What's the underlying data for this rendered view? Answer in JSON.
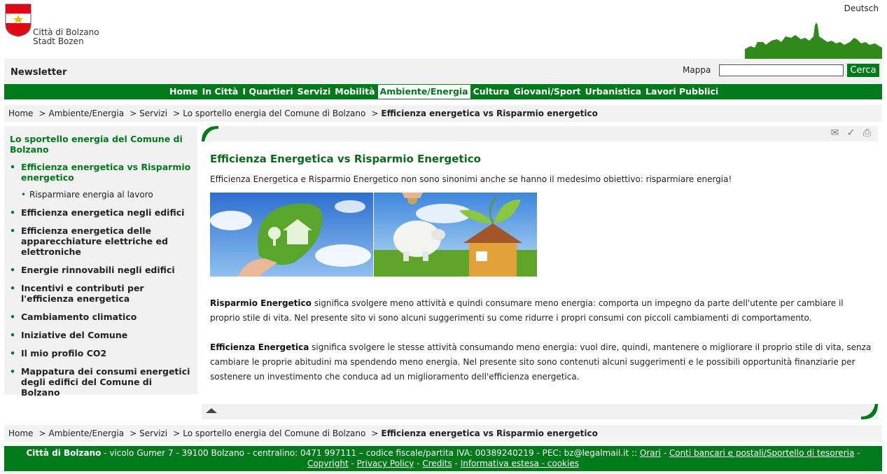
{
  "header": {
    "city_line1": "Città di Bolzano",
    "city_line2": "Stadt Bozen",
    "language_link": "Deutsch",
    "colors": {
      "brand_green": "#007a1a",
      "shield_red": "#e30613"
    }
  },
  "toolbar": {
    "newsletter": "Newsletter",
    "map_link": "Mappa",
    "search_value": "",
    "search_button": "Cerca"
  },
  "nav": {
    "items": [
      {
        "label": "Home"
      },
      {
        "label": "In Città"
      },
      {
        "label": "I Quartieri"
      },
      {
        "label": "Servizi"
      },
      {
        "label": "Mobilità"
      },
      {
        "label": "Ambiente/Energia"
      },
      {
        "label": "Cultura"
      },
      {
        "label": "Giovani/Sport"
      },
      {
        "label": "Urbanistica"
      },
      {
        "label": "Lavori Pubblici"
      }
    ],
    "active": "Ambiente/Energia"
  },
  "breadcrumb": {
    "items": [
      "Home",
      "Ambiente/Energia",
      "Servizi",
      "Lo sportello energia del Comune di Bolzano"
    ],
    "separator": ">",
    "current": "Efficienza energetica vs Risparmio energetico"
  },
  "sidebar": {
    "title": "Lo sportello energia del Comune di Bolzano",
    "items": [
      {
        "label": "Efficienza energetica vs Risparmio energetico"
      },
      {
        "label": "Risparmiare energia al lavoro"
      },
      {
        "label": "Efficienza energetica negli edifici"
      },
      {
        "label": "Efficienza energetica delle apparecchiature elettriche ed elettroniche"
      },
      {
        "label": "Energie rinnovabili negli edifici"
      },
      {
        "label": "Incentivi e contributi per l'efficienza energetica"
      },
      {
        "label": "Cambiamento climatico"
      },
      {
        "label": "Iniziative del Comune"
      },
      {
        "label": "Il mio profilo CO2"
      },
      {
        "label": "Mappatura dei consumi energetici degli edifici del Comune di Bolzano"
      }
    ]
  },
  "content": {
    "title": "Efficienza Energetica vs Risparmio Energetico",
    "intro": "Efficienza Energetica e Risparmio Energetico non sono sinonimi anche se hanno il medesimo obiettivo: risparmiare energia!",
    "para1_bold": "Risparmio Energetico",
    "para1_text": " significa svolgere meno attività e quindi consumare meno energia: comporta un impegno da parte dell'utente per cambiare il proprio stile di vita. Nel presente sito vi sono alcuni suggerimenti su come ridurre i propri consumi con piccoli cambiamenti di comportamento.",
    "para2_bold": "Efficienza Energetica",
    "para2_text": " significa svolgere le stesse attività consumando meno energia: vuol dire, quindi, mantenere o migliorare il proprio stile di vita, senza cambiare le proprie abitudini ma spendendo meno energia. Nel presente sito sono contenuti alcuni suggerimenti e le possibili opportunità finanziarie per sostenere un investimento che conduca ad un miglioramento dell'efficienza energetica."
  },
  "footer": {
    "org": "Città di Bolzano",
    "address": " - vicolo Gumer 7 - 39100 Bolzano - centralino: 0471 997111 – codice fiscale/partita IVA: 00389240219 - PEC: bz@legalmail.it :: ",
    "links": {
      "orari": "Orari",
      "conti": "Conti bancari e postali/Sportello di tesoreria",
      "copyright": "Copyright",
      "privacy": "Privacy Policy",
      "credits": "Credits",
      "cookies": "Informativa estesa - cookies"
    }
  }
}
